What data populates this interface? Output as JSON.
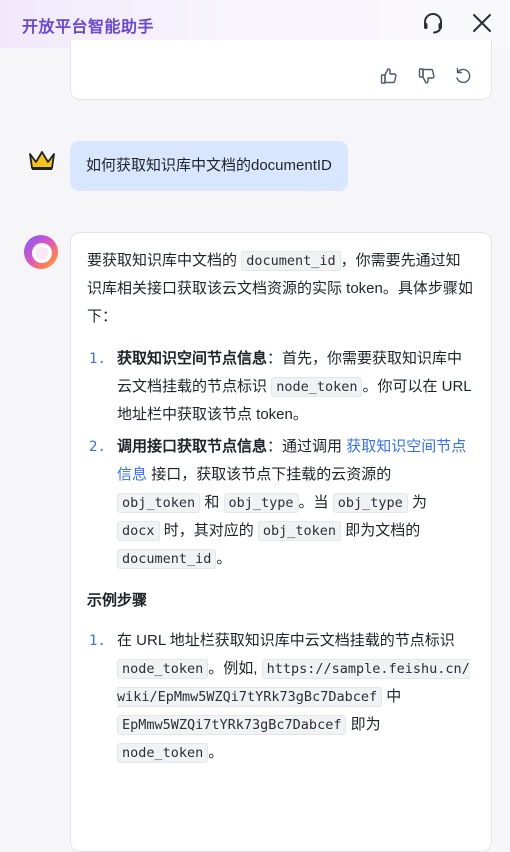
{
  "header": {
    "title": "开放平台智能助手"
  },
  "user_message": {
    "text": "如何获取知识库中文档的documentID"
  },
  "answer": {
    "intro_1": "要获取知识库中文档的",
    "intro_code": "document_id",
    "intro_2": "，你需要先通过知识库相关接口获取该云文档资源的实际 token。具体步骤如下：",
    "steps": [
      {
        "num": "1.",
        "bold": "获取知识空间节点信息",
        "t1": "：首先，你需要获取知识库中云文档挂载的节点标识",
        "code1": "node_token",
        "t2": "。你可以在 URL 地址栏中获取该节点 token。"
      },
      {
        "num": "2.",
        "bold": "调用接口获取节点信息",
        "t1": "：通过调用",
        "link": "获取知识空间节点信息",
        "t2": "接口，获取该节点下挂载的云资源的",
        "code1": "obj_token",
        "t3": "和",
        "code2": "obj_type",
        "t4": "。当",
        "code3": "obj_type",
        "t5": "为",
        "code4": "docx",
        "t6": "时，其对应的",
        "code5": "obj_token",
        "t7": "即为文档的",
        "code6": "document_id",
        "t8": "。"
      }
    ],
    "example_heading": "示例步骤",
    "example_steps": [
      {
        "num": "1.",
        "t1": "在 URL 地址栏获取知识库中云文档挂载的节点标识",
        "code1": "node_token",
        "t2": "。例如,",
        "code2": "https://sample.feishu.cn/wiki/EpMmw5WZQi7tYRk73gBc7Dabcef",
        "t3": "中",
        "code3": "EpMmw5WZQi7tYRk73gBc7Dabcef",
        "t4": "即为",
        "code4": "node_token",
        "t5": "。"
      }
    ]
  },
  "icons": {
    "headset": "headset-icon",
    "close": "close-icon",
    "thumbs_up": "thumbs-up-icon",
    "thumbs_down": "thumbs-down-icon",
    "refresh": "refresh-icon",
    "user_avatar": "crown-icon",
    "bot_avatar": "assistant-logo-icon"
  },
  "colors": {
    "accent": "#6b48d6",
    "link": "#3370ff",
    "user_bubble": "#d8e6ff",
    "crown": "#f5c518"
  }
}
